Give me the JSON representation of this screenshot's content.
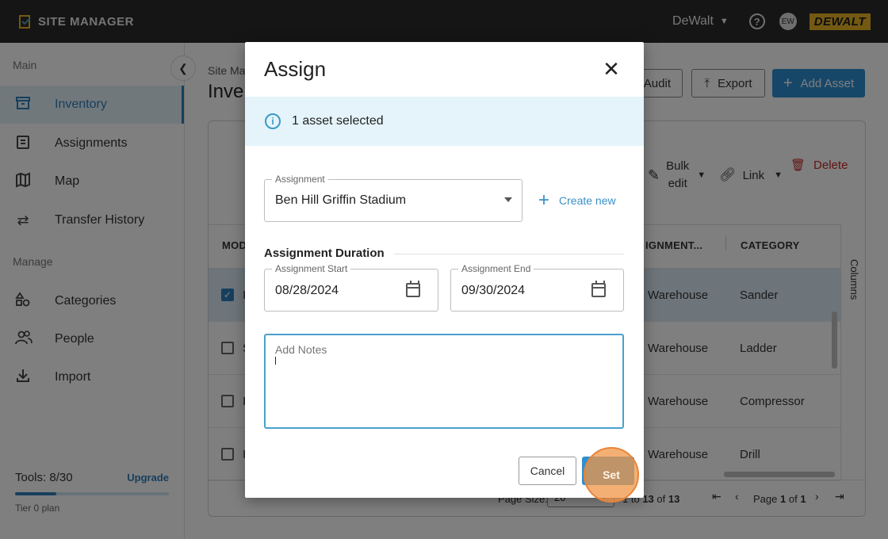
{
  "app": {
    "name": "SITE MANAGER",
    "company": "DeWalt",
    "user_initials": "EW",
    "logo_text": "DEWALT"
  },
  "sidebar": {
    "section_main": "Main",
    "section_manage": "Manage",
    "main_items": [
      {
        "label": "Inventory",
        "icon": "archive-box-icon",
        "active": true
      },
      {
        "label": "Assignments",
        "icon": "clipboard-icon"
      },
      {
        "label": "Map",
        "icon": "map-icon"
      },
      {
        "label": "Transfer History",
        "icon": "transfer-arrows-icon"
      }
    ],
    "manage_items": [
      {
        "label": "Categories",
        "icon": "shapes-icon"
      },
      {
        "label": "People",
        "icon": "people-icon"
      },
      {
        "label": "Import",
        "icon": "download-icon"
      }
    ],
    "tools_label": "Tools: 8/30",
    "upgrade_label": "Upgrade",
    "tools_progress": 0.27,
    "tier_label": "Tier 0 plan"
  },
  "main": {
    "breadcrumb": "Site Ma",
    "title": "Inven",
    "audit_label": "Audit",
    "export_label": "Export",
    "add_asset_label": "Add Asset",
    "bulk_edit_label_1": "Bulk",
    "bulk_edit_label_2": "edit",
    "link_label": "Link",
    "delete_label": "Delete",
    "columns_label": "Columns",
    "table": {
      "headers": {
        "model": "MOD",
        "assignment": "IGNMENT...",
        "category": "CATEGORY"
      },
      "rows": [
        {
          "model": "I",
          "assignment": "Warehouse",
          "category": "Sander",
          "selected": true
        },
        {
          "model": "S",
          "assignment": "Warehouse",
          "category": "Ladder",
          "selected": false
        },
        {
          "model": "I",
          "assignment": "Warehouse",
          "category": "Compressor",
          "selected": false
        },
        {
          "model": "I",
          "assignment": "Warehouse",
          "category": "Drill",
          "selected": false
        }
      ]
    },
    "footer": {
      "page_size_label": "Page Size:",
      "page_size_value": "20",
      "range_prefix": "1 to",
      "range_end": "13",
      "range_of": "of",
      "range_total": "13",
      "page_label": "Page",
      "page_current": "1",
      "page_of": "of",
      "page_total": "1"
    }
  },
  "dialog": {
    "title": "Assign",
    "info_text": "1 asset selected",
    "assignment_label": "Assignment",
    "assignment_value": "Ben Hill Griffin Stadium",
    "create_new_label": "Create new",
    "duration_title": "Assignment Duration",
    "start_label": "Assignment Start",
    "start_value": "08/28/2024",
    "end_label": "Assignment End",
    "end_value": "09/30/2024",
    "notes_placeholder": "Add Notes",
    "cancel_label": "Cancel",
    "set_label": "Set"
  },
  "colors": {
    "accent": "#2f8fd0",
    "active_nav": "#2f7fba",
    "delete": "#c62828",
    "brand_yellow": "#e7b224",
    "click_highlight": "#f09646"
  }
}
